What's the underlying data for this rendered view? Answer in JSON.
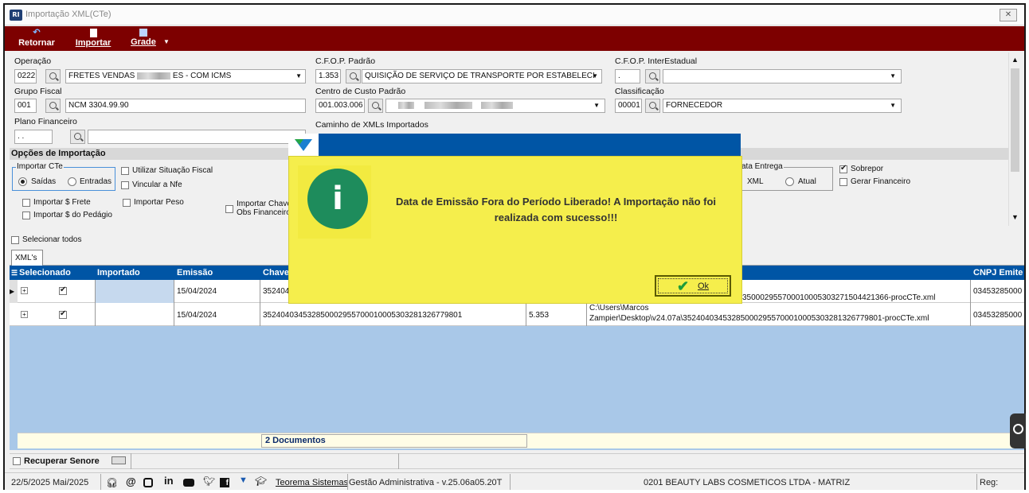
{
  "window": {
    "title": "Importação XML(CTe)",
    "app_icon_text": "RI"
  },
  "toolbar": {
    "retornar": "Retornar",
    "importar": "Importar",
    "grade": "Grade"
  },
  "form": {
    "operacao": {
      "label": "Operação",
      "code": "0222",
      "value_prefix": "FRETES VENDAS",
      "value_suffix": "ES - COM ICMS"
    },
    "cfop_padrao": {
      "label": "C.F.O.P. Padrão",
      "code": "1.353",
      "value": "QUISIÇÃO DE SERVIÇO DE TRANSPORTE POR ESTABELECI"
    },
    "cfop_interestadual": {
      "label": "C.F.O.P. InterEstadual",
      "code": "."
    },
    "grupo_fiscal": {
      "label": "Grupo Fiscal",
      "code": "001",
      "value": "NCM 3304.99.90"
    },
    "centro_custo": {
      "label": "Centro de Custo Padrão",
      "code": "001.003.006"
    },
    "classificacao": {
      "label": "Classificação",
      "code": "00001",
      "value": "FORNECEDOR"
    },
    "plano_financeiro": {
      "label": "Plano Financeiro",
      "code": ". ."
    },
    "caminho": {
      "label": "Caminho de XMLs Importados"
    }
  },
  "opcoes": {
    "title": "Opções de Importação",
    "importar_cte": "Importar CTe",
    "saidas": "Saídas",
    "entradas": "Entradas",
    "utilizar_situacao": "Utilizar Situação Fiscal",
    "vincular_nfe": "Vincular a Nfe",
    "importar_frete": "Importar $ Frete",
    "importar_pedagio": "Importar $ do Pedágio",
    "importar_peso": "Importar Peso",
    "importar_chave": "Importar Chave",
    "obs_financeiro": "Obs Financeiro",
    "data_entrega": "ata Entrega",
    "xml": "XML",
    "atual": "Atual",
    "sobrepor": "Sobrepor",
    "gerar_financeiro": "Gerar Financeiro",
    "selecionar_todos": "Selecionar todos"
  },
  "tab": {
    "label": "XML's"
  },
  "grid": {
    "headers": {
      "selecionado": "Selecionado",
      "importado": "Importado",
      "emissao": "Emissão",
      "chave": "Chave",
      "cnpj": "CNPJ Emite"
    },
    "rows": [
      {
        "emissao": "15/04/2024",
        "chave": "352404",
        "path": "350002955700010005303271504421366-procCTe.xml",
        "cnpj": "03453285000"
      },
      {
        "emissao": "15/04/2024",
        "chave": "352404034532850002955700010005303281326779801",
        "cfop": "5.353",
        "path_line1": "C:\\Users\\Marcos",
        "path_line2": "Zampier\\Desktop\\v24.07a\\352404034532850002955700010005303281326779801-procCTe.xml",
        "cnpj": "03453285000"
      }
    ],
    "summary": "2 Documentos"
  },
  "bottom": {
    "recuperar": "Recuperar Senore"
  },
  "status": {
    "date": "22/5/2025 Mai/2025",
    "company_link": "Teorema Sistemas",
    "version": "Gestão Administrativa - v.25.06a05.20T",
    "empresa": "0201 BEAUTY LABS COSMETICOS LTDA - MATRIZ",
    "reg": "Reg: BELEZI"
  },
  "dialog": {
    "message": "Data de Emissão Fora do Período Liberado! A Importação não foi realizada com sucesso!!!",
    "ok_label": "Ok",
    "info_glyph": "i"
  },
  "colors": {
    "toolbar": "#7d0000",
    "grid_header": "#0055a5",
    "grid_bg": "#a9c8e8",
    "dialog_bg": "#f5ee4c",
    "info_icon": "#1e8c5c"
  }
}
